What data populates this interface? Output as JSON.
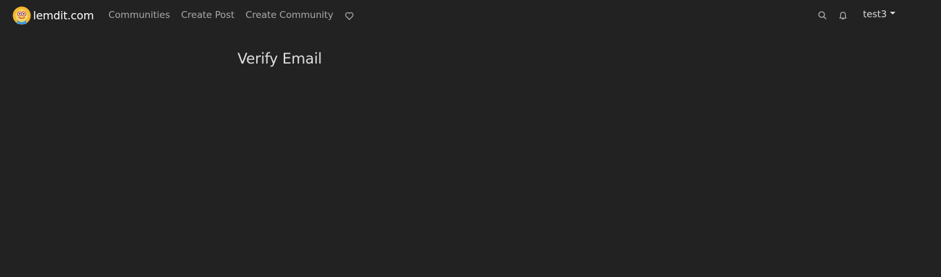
{
  "navbar": {
    "brand_name": "lemdit.com",
    "links": {
      "communities": "Communities",
      "create_post": "Create Post",
      "create_community": "Create Community"
    },
    "user": {
      "username": "test3"
    }
  },
  "main": {
    "title": "Verify Email"
  },
  "colors": {
    "background": "#222222",
    "nav_link": "#aaaaaa",
    "text": "#dedede"
  },
  "icons": {
    "logo": "lemmy-logo-icon",
    "donate": "heart-icon",
    "search": "search-icon",
    "notifications": "bell-icon",
    "dropdown": "caret-down-icon"
  }
}
